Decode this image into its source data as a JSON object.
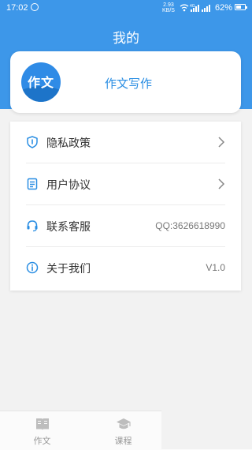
{
  "status_bar": {
    "time": "17:02",
    "speed_value": "2.93",
    "speed_unit": "KB/S",
    "network": "4G",
    "battery_text": "62%",
    "battery_level": 0.62
  },
  "header": {
    "title": "我的"
  },
  "profile": {
    "avatar_text": "作文",
    "app_name": "作文写作"
  },
  "menu": {
    "items": [
      {
        "label": "隐私政策",
        "icon": "shield-icon",
        "value": ""
      },
      {
        "label": "用户协议",
        "icon": "document-icon",
        "value": ""
      },
      {
        "label": "联系客服",
        "icon": "headset-icon",
        "value": "QQ:3626618990"
      },
      {
        "label": "关于我们",
        "icon": "info-icon",
        "value": "V1.0"
      }
    ]
  },
  "tabs": [
    {
      "label": "作文",
      "icon": "book-icon"
    },
    {
      "label": "课程",
      "icon": "graduation-cap-icon"
    }
  ],
  "colors": {
    "accent": "#3d97e9",
    "icon_blue": "#2a8ee3"
  }
}
